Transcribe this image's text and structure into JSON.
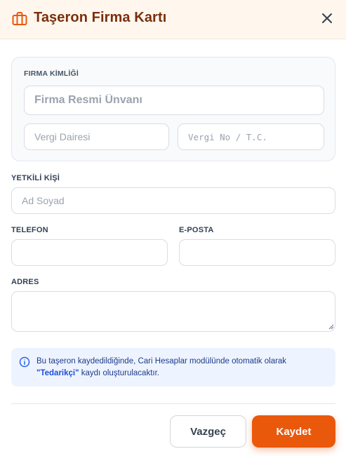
{
  "dialog": {
    "title": "Taşeron Firma Kartı",
    "icon": "briefcase-icon",
    "close_icon": "close-icon"
  },
  "identity": {
    "section_label": "FIRMA KİMLİĞİ",
    "company_name": {
      "placeholder": "Firma Resmi Ünvanı",
      "value": ""
    },
    "tax_office": {
      "placeholder": "Vergi Dairesi",
      "value": ""
    },
    "tax_number": {
      "placeholder": "Vergi No / T.C.",
      "value": ""
    }
  },
  "contact": {
    "label": "YETKİLİ KİŞİ",
    "placeholder": "Ad Soyad",
    "value": ""
  },
  "phone": {
    "label": "TELEFON",
    "value": ""
  },
  "email": {
    "label": "E-POSTA",
    "value": ""
  },
  "address": {
    "label": "ADRES",
    "value": ""
  },
  "info": {
    "icon": "info-icon",
    "text_before": "Bu taşeron kaydedildiğinde, Cari Hesaplar modülünde otomatik olarak ",
    "highlight": "\"Tedarikçi\"",
    "text_after": " kaydı oluşturulacaktır."
  },
  "actions": {
    "cancel_label": "Vazgeç",
    "save_label": "Kaydet"
  },
  "colors": {
    "accent": "#ea580c",
    "title": "#7a2f0c",
    "header_bg": "#fff7ee",
    "info_bg": "#eef4ff",
    "info_text": "#1e3a8a"
  }
}
